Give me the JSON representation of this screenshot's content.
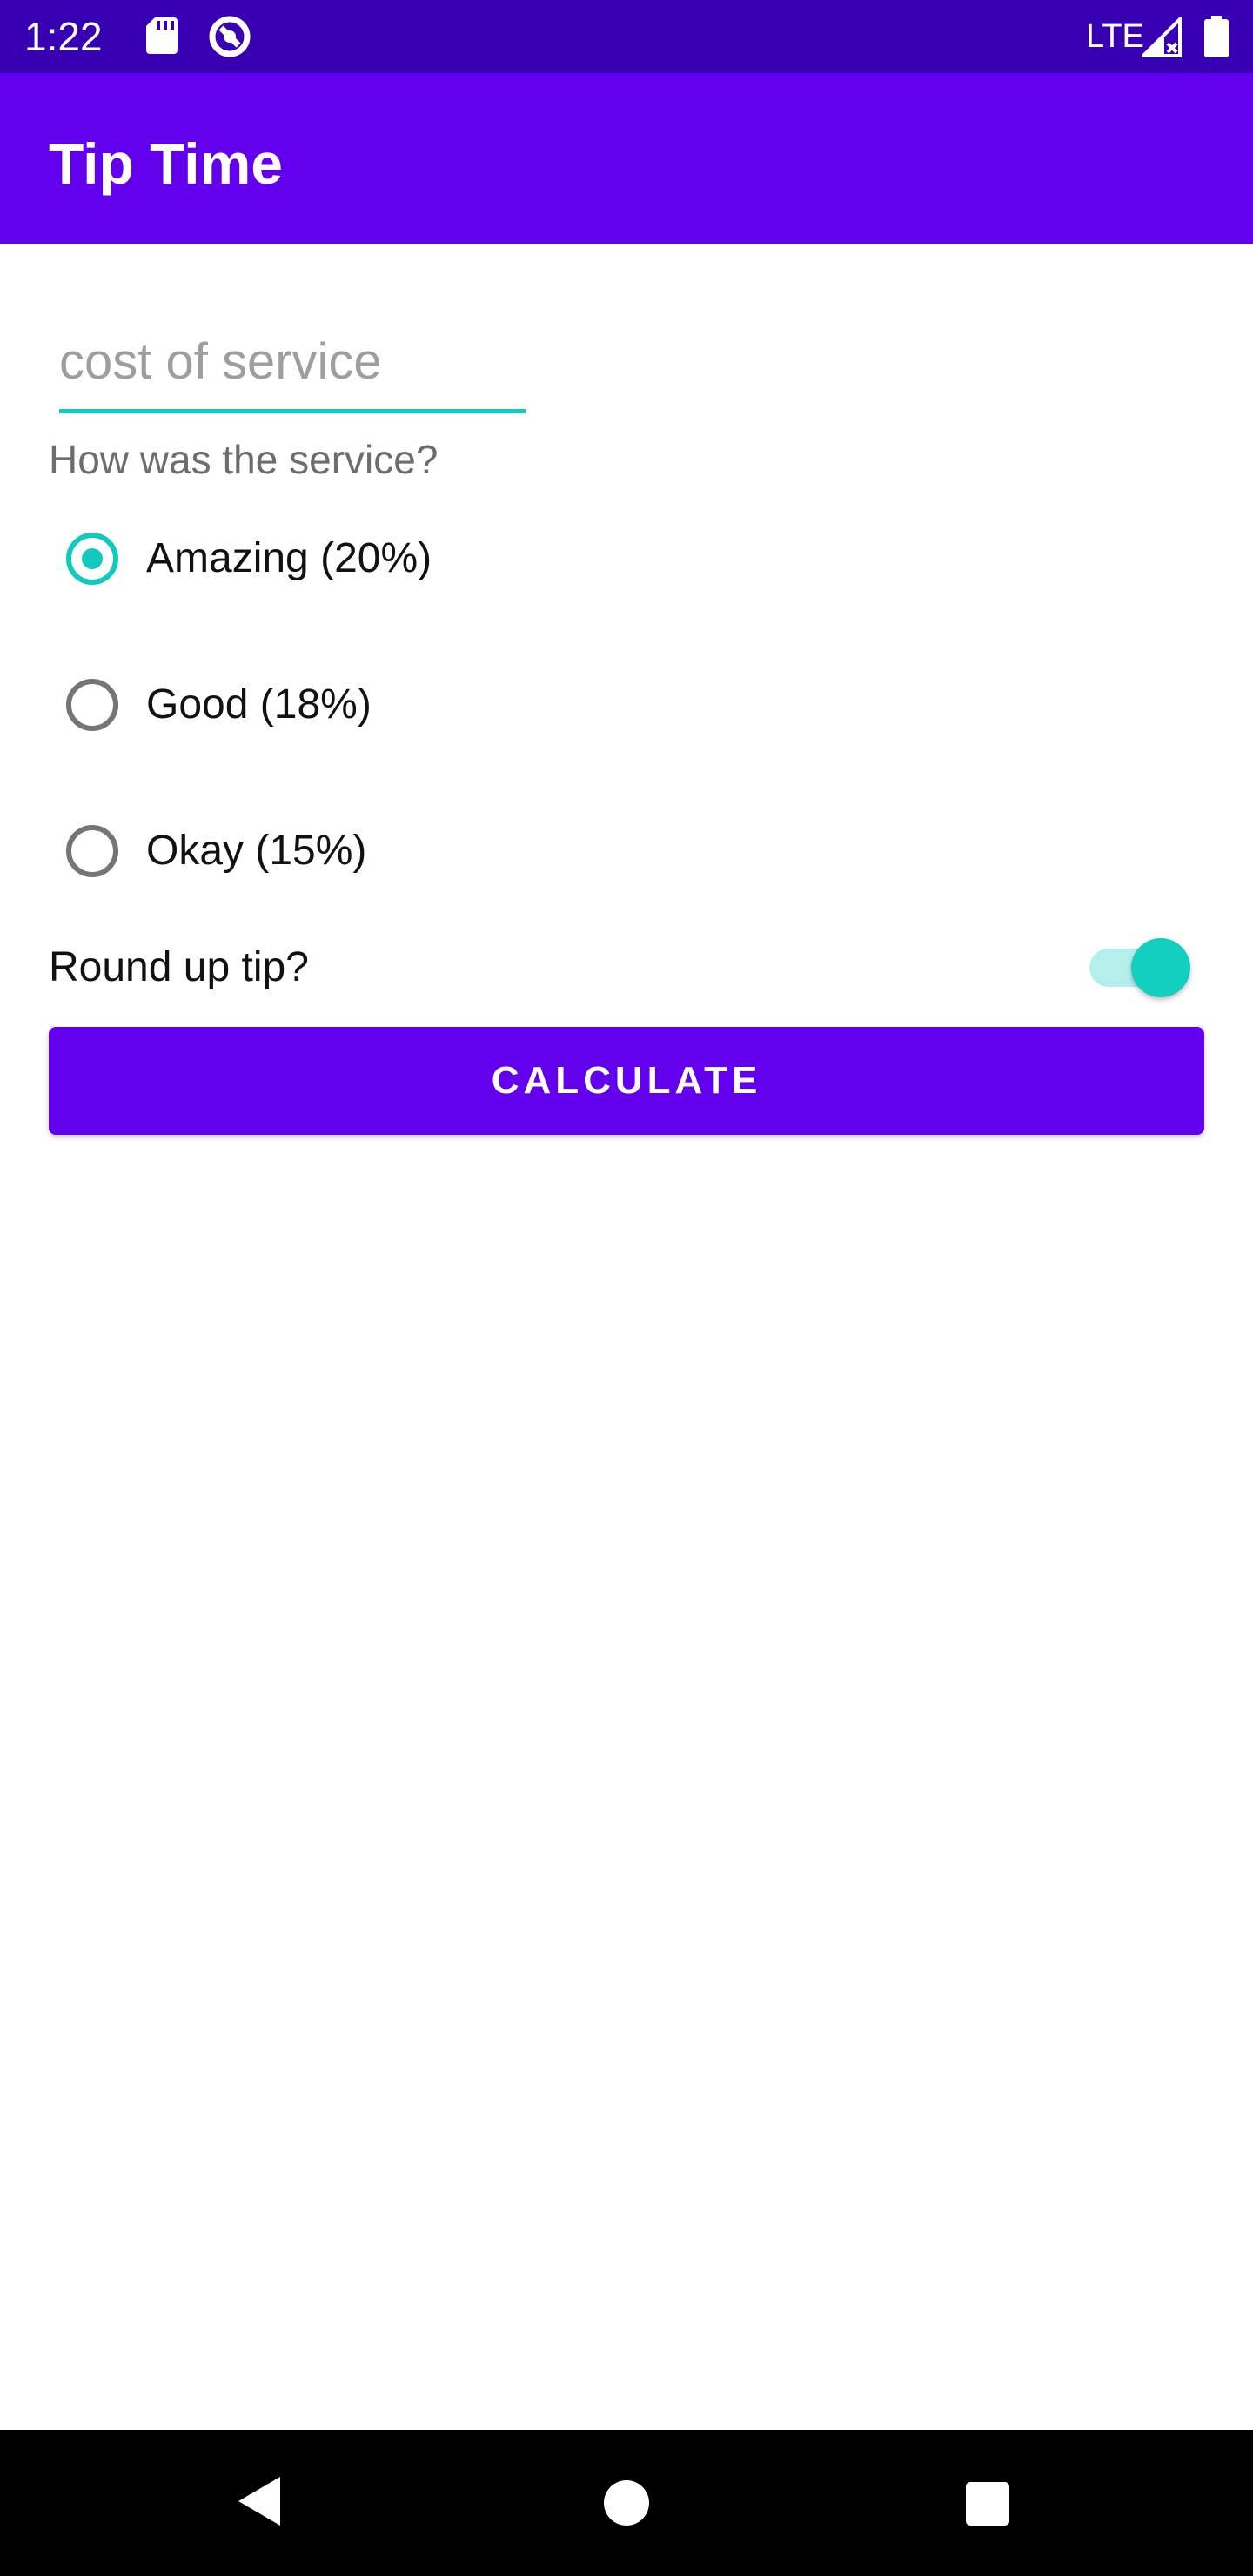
{
  "status_bar": {
    "time": "1:22",
    "network": "LTE",
    "icons": [
      "sd-card-icon",
      "data-saver-icon",
      "signal-icon",
      "battery-icon"
    ]
  },
  "app_bar": {
    "title": "Tip Time"
  },
  "form": {
    "cost_placeholder": "cost of service",
    "cost_value": "",
    "question": "How was the service?",
    "options": [
      {
        "label": "Amazing (20%)",
        "checked": true
      },
      {
        "label": "Good (18%)",
        "checked": false
      },
      {
        "label": "Okay (15%)",
        "checked": false
      }
    ],
    "round_up_label": "Round up tip?",
    "round_up_on": true,
    "calculate_label": "CALCULATE"
  },
  "colors": {
    "status_bar": "#3700b3",
    "primary": "#6200ee",
    "accent": "#12c9bd"
  },
  "nav_bar": {
    "icons": [
      "back-icon",
      "home-icon",
      "recents-icon"
    ]
  }
}
